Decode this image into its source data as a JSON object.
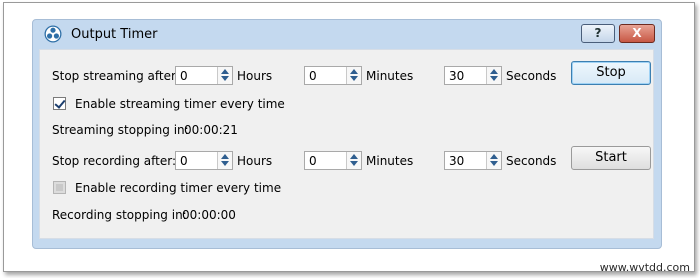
{
  "window": {
    "title": "Output Timer",
    "help_label": "?",
    "close_label": "X"
  },
  "streaming": {
    "stop_after_label": "Stop streaming after:",
    "hours": {
      "value": "0",
      "unit": "Hours"
    },
    "minutes": {
      "value": "0",
      "unit": "Minutes"
    },
    "seconds": {
      "value": "30",
      "unit": "Seconds"
    },
    "checkbox_label": "Enable streaming timer every time",
    "checkbox_checked": true,
    "stopping_in_label": "Streaming stopping in:",
    "stopping_in_value": "00:00:21",
    "button_label": "Stop"
  },
  "recording": {
    "stop_after_label": "Stop recording after:",
    "hours": {
      "value": "0",
      "unit": "Hours"
    },
    "minutes": {
      "value": "0",
      "unit": "Minutes"
    },
    "seconds": {
      "value": "30",
      "unit": "Seconds"
    },
    "checkbox_label": "Enable recording timer every time",
    "checkbox_checked": false,
    "stopping_in_label": "Recording stopping in:",
    "stopping_in_value": "00:00:00",
    "button_label": "Start"
  },
  "watermark": "www.wvtdd.com",
  "colors": {
    "window_frame": "#c4d9ef",
    "client_bg": "#f0f0f0",
    "close_button": "#c75845",
    "spin_arrow": "#2f5e8f"
  },
  "icons": {
    "app": "obs-logo-icon"
  }
}
